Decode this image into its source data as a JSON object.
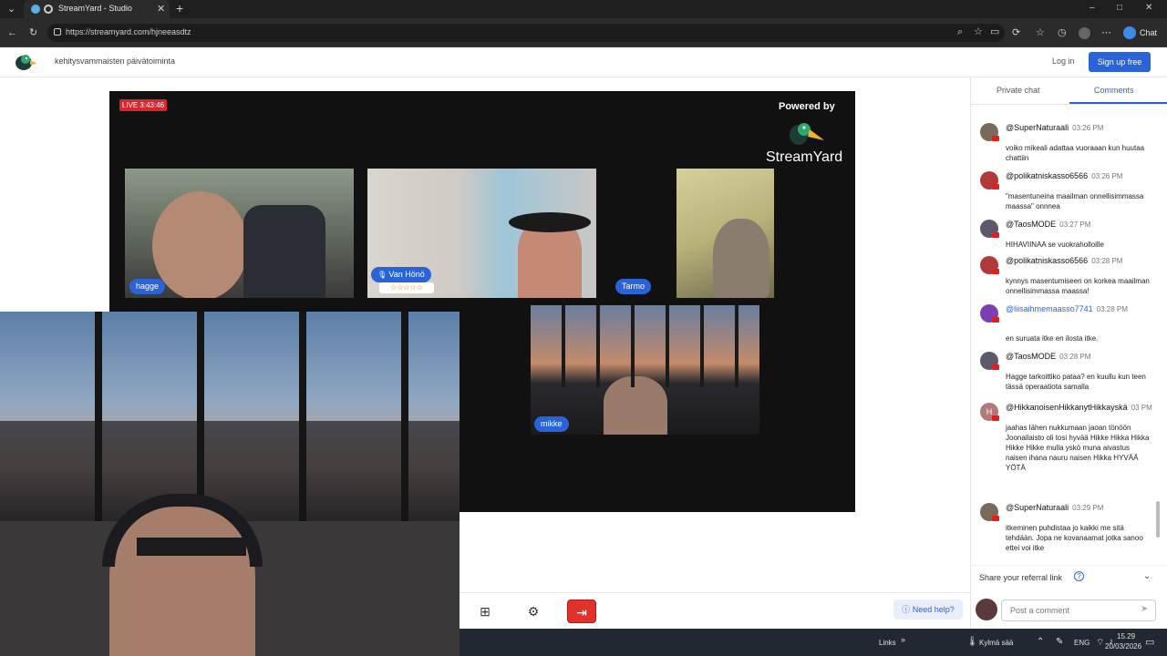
{
  "browser": {
    "tab_title": "StreamYard - Studio",
    "new_tab_symbol": "+",
    "url": "https://streamyard.com/hjneeasdtz",
    "chat_label": "Chat",
    "window_controls": [
      "–",
      "□",
      "✕"
    ]
  },
  "site": {
    "studio_title": "kehitysvammaisten päivätoiminta",
    "login_label": "Log in",
    "signup_label": "Sign up free"
  },
  "stage": {
    "live_badge": "LIVE 3:43:46",
    "powered_by": "Powered by",
    "brand": "StreamYard",
    "participants": [
      {
        "name": "hagge"
      },
      {
        "name": "Van Hönö",
        "stars": "☆☆☆☆☆"
      },
      {
        "name": "Tarmo"
      },
      {
        "name": "mikke"
      }
    ]
  },
  "controls": {
    "need_help_label": "Need help?"
  },
  "panel": {
    "tab_private": "Private chat",
    "tab_comments": "Comments",
    "comments": [
      {
        "author": "@SuperNaturaali",
        "time": "03:26 PM",
        "text": "voiko mikeali adattaa vuoraaan kun huutaa chattiin",
        "avatar_color": "#7a6a5a"
      },
      {
        "author": "@polikatniskasso6566",
        "time": "03:26 PM",
        "text": "\"masentuneina maailman onnellisimmassa maassa\" onnnea",
        "avatar_color": "#b03a3a"
      },
      {
        "author": "@TaosMODE",
        "time": "03:27 PM",
        "text": "HIHAVIINAA se vuokraholloille",
        "avatar_color": "#5a5a6a"
      },
      {
        "author": "@polikatniskasso6566",
        "time": "03:28 PM",
        "text": "kynnys masentumiseen on korkea maailman onnellisimmassa maassa!",
        "avatar_color": "#b03a3a"
      },
      {
        "author": "@liisaihmemaasso7741",
        "time": "03:28 PM",
        "text": "en suruata itke en ilosta itke.",
        "avatar_color": "#7b3fb5"
      },
      {
        "author": "@TaosMODE",
        "time": "03:28 PM",
        "text": "Hagge tarkoittiko pataa? en kuullu kun teen tässä operaatiota samalla",
        "avatar_color": "#5a5a6a"
      },
      {
        "author": "@HikkanoisenHikkanytHikkayskä",
        "time": "03 PM",
        "text": "jaahas lähen nukkumaan jaoan tönöön Joonailaisto oli tosi hyvää Hikke Hikka Hikka Hikke Hikke mulla yskö muna aivastus naisen ihana nauru naisen Hikka HYVÄÄ YÖTÄ",
        "avatar_color": "#b07a7a",
        "initial": "H"
      },
      {
        "author": "@SuperNaturaali",
        "time": "03:29 PM",
        "text": "itkeminen puhdistaa jo kaikki me sitä tehdään. Jopa ne kovanaamat jotka sanoo ettei voi itke",
        "avatar_color": "#7a6a5a"
      }
    ],
    "referral_label": "Share your referral link",
    "comment_placeholder": "Post a comment"
  },
  "taskbar": {
    "links": "Links",
    "weather": "Kylmä sää",
    "lang": "ENG",
    "time": "15.29",
    "date": "20/03/2026"
  }
}
